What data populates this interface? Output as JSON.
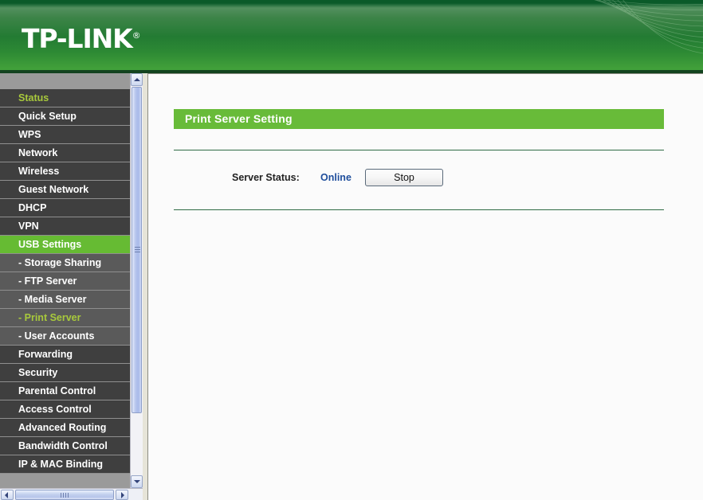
{
  "header": {
    "brand": "TP-LINK",
    "trademark": "®"
  },
  "sidebar": {
    "items": [
      {
        "label": "Status",
        "type": "top",
        "state": "accent"
      },
      {
        "label": "Quick Setup",
        "type": "top",
        "state": "normal"
      },
      {
        "label": "WPS",
        "type": "top",
        "state": "normal"
      },
      {
        "label": "Network",
        "type": "top",
        "state": "normal"
      },
      {
        "label": "Wireless",
        "type": "top",
        "state": "normal"
      },
      {
        "label": "Guest Network",
        "type": "top",
        "state": "normal"
      },
      {
        "label": "DHCP",
        "type": "top",
        "state": "normal"
      },
      {
        "label": "VPN",
        "type": "top",
        "state": "normal"
      },
      {
        "label": "USB Settings",
        "type": "top",
        "state": "selected"
      },
      {
        "label": "- Storage Sharing",
        "type": "sub",
        "state": "normal"
      },
      {
        "label": "- FTP Server",
        "type": "sub",
        "state": "normal"
      },
      {
        "label": "- Media Server",
        "type": "sub",
        "state": "normal"
      },
      {
        "label": "- Print Server",
        "type": "sub",
        "state": "accent"
      },
      {
        "label": "- User Accounts",
        "type": "sub",
        "state": "normal"
      },
      {
        "label": "Forwarding",
        "type": "top",
        "state": "normal"
      },
      {
        "label": "Security",
        "type": "top",
        "state": "normal"
      },
      {
        "label": "Parental Control",
        "type": "top",
        "state": "normal"
      },
      {
        "label": "Access Control",
        "type": "top",
        "state": "normal"
      },
      {
        "label": "Advanced Routing",
        "type": "top",
        "state": "normal"
      },
      {
        "label": "Bandwidth Control",
        "type": "top",
        "state": "normal"
      },
      {
        "label": "IP & MAC Binding",
        "type": "top",
        "state": "normal"
      }
    ]
  },
  "main": {
    "panel_title": "Print Server Setting",
    "status_label": "Server Status:",
    "status_value": "Online",
    "stop_button_label": "Stop"
  },
  "colors": {
    "brand_green": "#68bb39",
    "header_dark_green": "#0a5a29",
    "menu_bg": "#3f3f3f",
    "menu_sub_bg": "#5a5a5a",
    "menu_accent_text": "#a8c93c",
    "status_value_color": "#1f4e9c",
    "rule_green": "#2f6b44"
  }
}
